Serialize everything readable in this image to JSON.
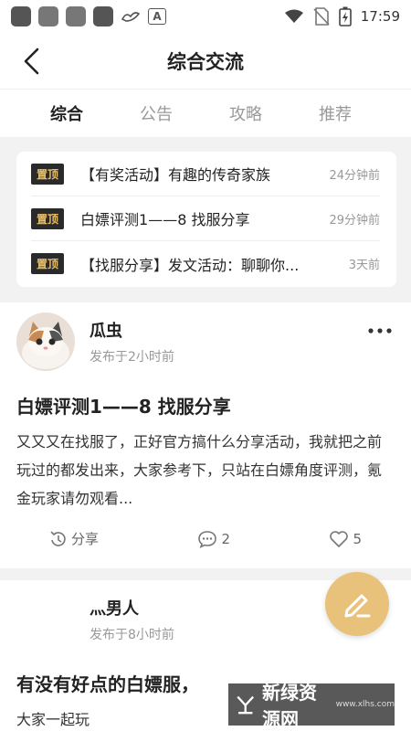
{
  "status_bar": {
    "time": "17:59",
    "colors": {
      "icon": "#555555"
    }
  },
  "nav": {
    "title": "综合交流",
    "back_icon": "chevron-left-icon"
  },
  "tabs": [
    {
      "label": "综合",
      "active": true
    },
    {
      "label": "公告",
      "active": false
    },
    {
      "label": "攻略",
      "active": false
    },
    {
      "label": "推荐",
      "active": false
    }
  ],
  "pinned": [
    {
      "tag": "置顶",
      "title": "【有奖活动】有趣的传奇家族",
      "time": "24分钟前"
    },
    {
      "tag": "置顶",
      "title": "白嫖评测1——8  找服分享",
      "time": "29分钟前"
    },
    {
      "tag": "置顶",
      "title": "【找服分享】发文活动：聊聊你...",
      "time": "3天前"
    }
  ],
  "posts": [
    {
      "author": "瓜虫",
      "time": "发布于2小时前",
      "title": "白嫖评测1——8  找服分享",
      "body": "又又又在找服了，正好官方搞什么分享活动，我就把之前玩过的都发出来，大家参考下，只站在白嫖角度评测，氪金玩家请勿观看...",
      "share_label": "分享",
      "comments": "2",
      "likes": "5"
    },
    {
      "author": "灬男人",
      "time": "发布于8小时前",
      "title": "有没有好点的白嫖服，",
      "body": "大家一起玩"
    }
  ],
  "fab_icon": "pencil-icon",
  "watermark": {
    "text": "新绿资源网",
    "sub": "www.xlhs.com"
  },
  "colors": {
    "accent": "#e8c27a",
    "pin_tag_bg": "#2a2a2a",
    "pin_tag_text": "#e8c06a"
  }
}
